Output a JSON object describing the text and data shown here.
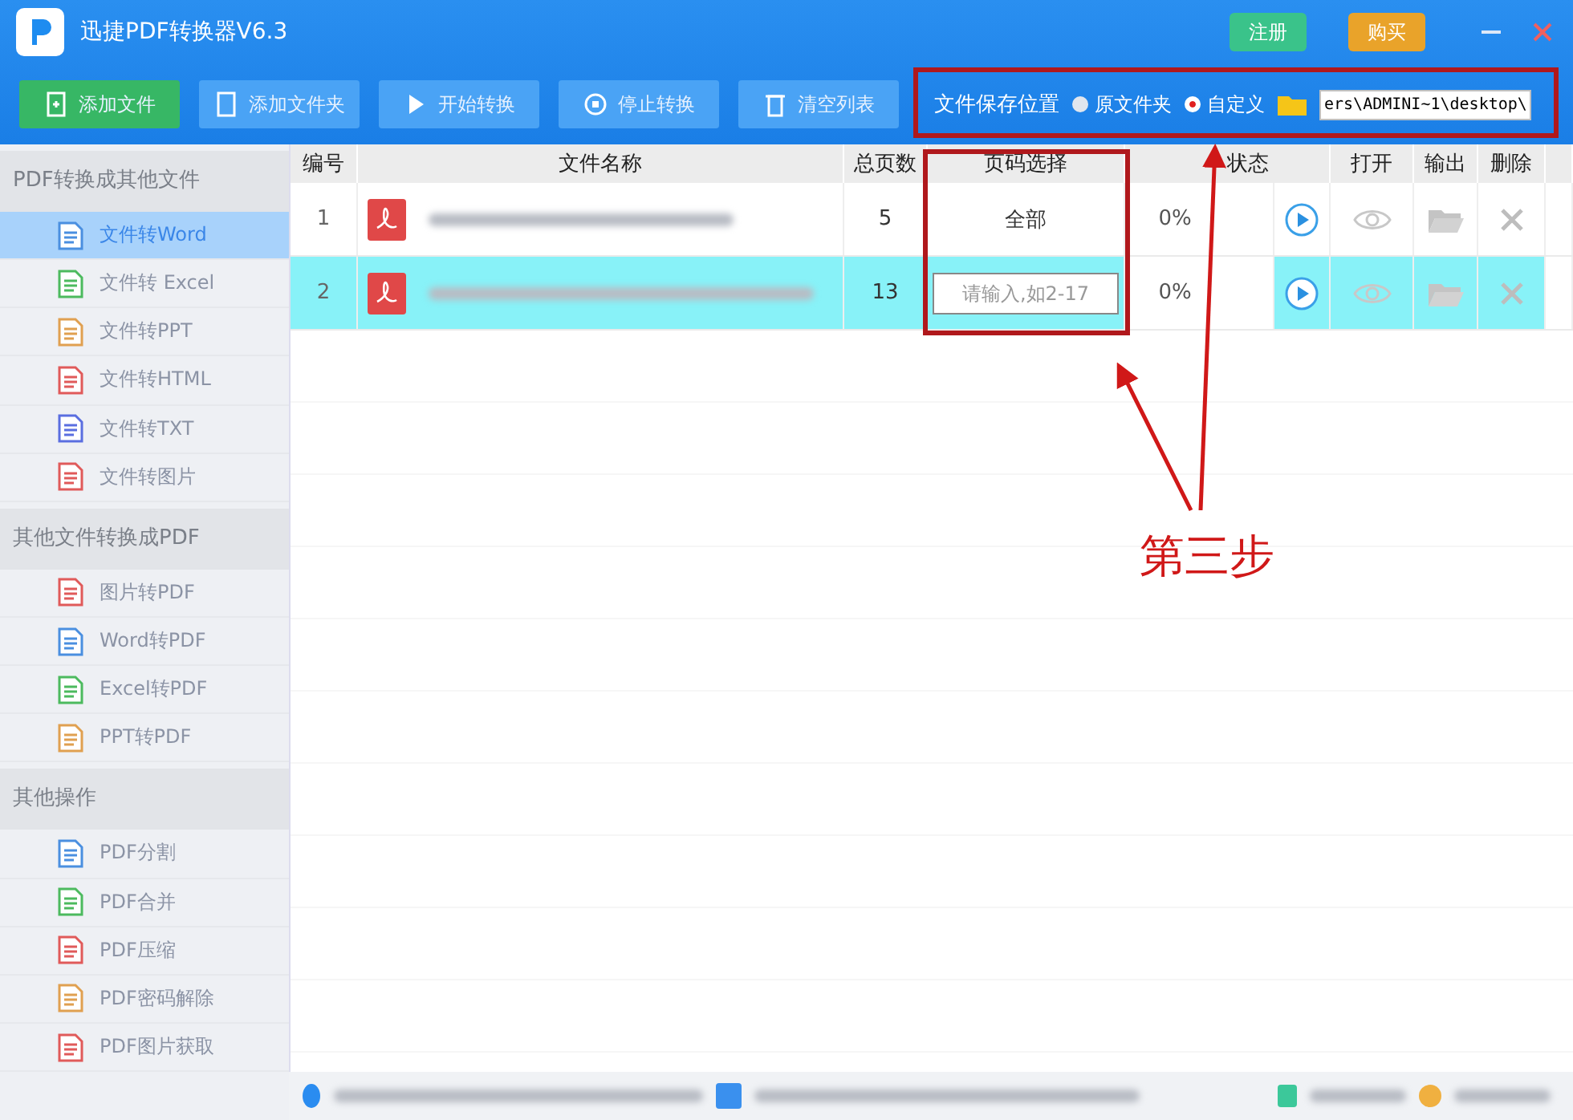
{
  "window": {
    "title": "迅捷PDF转换器V6.3",
    "buttons": [
      {
        "label": "注册",
        "kind": "register"
      },
      {
        "label": "购买",
        "kind": "buy"
      }
    ]
  },
  "toolbar": {
    "buttons": [
      {
        "label": "添加文件",
        "kind": "primary"
      },
      {
        "label": "添加文件夹",
        "kind": "normal"
      },
      {
        "label": "开始转换",
        "kind": "normal"
      },
      {
        "label": "停止转换",
        "kind": "normal"
      },
      {
        "label": "清空列表",
        "kind": "normal"
      }
    ],
    "save_location": {
      "label": "文件保存位置",
      "options": [
        {
          "label": "原文件夹",
          "selected": false
        },
        {
          "label": "自定义",
          "selected": true
        }
      ],
      "path": "ers\\ADMINI~1\\desktop\\"
    }
  },
  "sidebar": {
    "sections": [
      {
        "title": "PDF转换成其他文件",
        "items": [
          {
            "label": "文件转Word",
            "color": "#4a8fe0",
            "selected": true
          },
          {
            "label": "文件转 Excel",
            "color": "#4cba5e",
            "selected": false
          },
          {
            "label": "文件转PPT",
            "color": "#e0a050",
            "selected": false
          },
          {
            "label": "文件转HTML",
            "color": "#e05a5a",
            "selected": false
          },
          {
            "label": "文件转TXT",
            "color": "#5a6ee0",
            "selected": false
          },
          {
            "label": "文件转图片",
            "color": "#e05a5a",
            "selected": false
          }
        ]
      },
      {
        "title": "其他文件转换成PDF",
        "items": [
          {
            "label": "图片转PDF",
            "color": "#e05a5a",
            "selected": false
          },
          {
            "label": "Word转PDF",
            "color": "#4a8fe0",
            "selected": false
          },
          {
            "label": "Excel转PDF",
            "color": "#4cba5e",
            "selected": false
          },
          {
            "label": "PPT转PDF",
            "color": "#e0a050",
            "selected": false
          }
        ]
      },
      {
        "title": "其他操作",
        "items": [
          {
            "label": "PDF分割",
            "color": "#4a8fe0",
            "selected": false
          },
          {
            "label": "PDF合并",
            "color": "#4cba5e",
            "selected": false
          },
          {
            "label": "PDF压缩",
            "color": "#e05a5a",
            "selected": false
          },
          {
            "label": "PDF密码解除",
            "color": "#e0a050",
            "selected": false
          },
          {
            "label": "PDF图片获取",
            "color": "#e05a5a",
            "selected": false
          }
        ]
      }
    ]
  },
  "table": {
    "columns": [
      "编号",
      "文件名称",
      "总页数",
      "页码选择",
      "状态",
      "打开",
      "输出",
      "删除"
    ],
    "rows": [
      {
        "number": "1",
        "pages": "5",
        "page_selection": {
          "kind": "text",
          "value": "全部"
        },
        "status": "0%",
        "selected": false
      },
      {
        "number": "2",
        "pages": "13",
        "page_selection": {
          "kind": "input",
          "placeholder": "请输入,如2-17"
        },
        "status": "0%",
        "selected": true
      }
    ]
  },
  "annotation": {
    "label": "第三步"
  }
}
